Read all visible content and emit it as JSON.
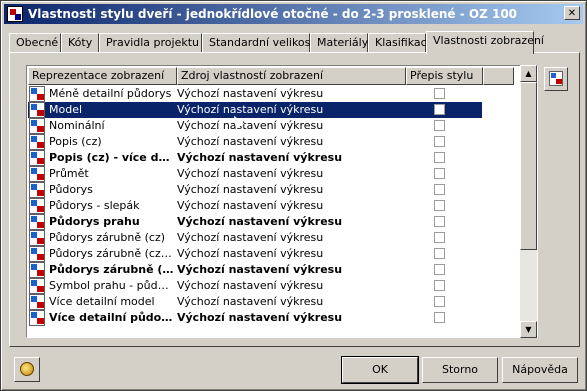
{
  "window": {
    "title": "Vlastnosti stylu dveří - jednokřídlové otočné - do 2-3 prosklené - OZ 100"
  },
  "tabs": [
    {
      "label": "Obecné"
    },
    {
      "label": "Kóty"
    },
    {
      "label": "Pravidla projektu"
    },
    {
      "label": "Standardní velikosti"
    },
    {
      "label": "Materiály"
    },
    {
      "label": "Klasifikace"
    },
    {
      "label": "Vlastnosti zobrazení",
      "active": true
    }
  ],
  "list": {
    "headers": {
      "representation": "Reprezentace zobrazení",
      "source": "Zdroj vlastností zobrazení",
      "override": "Přepis stylu"
    },
    "rows": [
      {
        "name": "Méně detailní půdorys",
        "source": "Výchozí nastavení výkresu",
        "bold": false,
        "selected": false
      },
      {
        "name": "Model",
        "source": "Výchozí nastavení výkresu",
        "bold": false,
        "selected": true
      },
      {
        "name": "Nominální",
        "source": "Výchozí nastavení výkresu",
        "bold": false,
        "selected": false
      },
      {
        "name": "Popis (cz)",
        "source": "Výchozí nastavení výkresu",
        "bold": false,
        "selected": false
      },
      {
        "name": "Popis (cz) - více det...",
        "source": "Výchozí nastavení výkresu",
        "bold": true,
        "selected": false
      },
      {
        "name": "Průmět",
        "source": "Výchozí nastavení výkresu",
        "bold": false,
        "selected": false
      },
      {
        "name": "Půdorys",
        "source": "Výchozí nastavení výkresu",
        "bold": false,
        "selected": false
      },
      {
        "name": "Půdorys - slepák",
        "source": "Výchozí nastavení výkresu",
        "bold": false,
        "selected": false
      },
      {
        "name": "Půdorys prahu",
        "source": "Výchozí nastavení výkresu",
        "bold": true,
        "selected": false
      },
      {
        "name": "Půdorys zárubně (cz)",
        "source": "Výchozí nastavení výkresu",
        "bold": false,
        "selected": false
      },
      {
        "name": "Půdorys zárubně (cz) - ...",
        "source": "Výchozí nastavení výkresu",
        "bold": false,
        "selected": false
      },
      {
        "name": "Půdorys zárubně (cz...",
        "source": "Výchozí nastavení výkresu",
        "bold": true,
        "selected": false
      },
      {
        "name": "Symbol prahu - půdorys",
        "source": "Výchozí nastavení výkresu",
        "bold": false,
        "selected": false
      },
      {
        "name": "Více detailní model",
        "source": "Výchozí nastavení výkresu",
        "bold": false,
        "selected": false
      },
      {
        "name": "Více detailní půdorys",
        "source": "Výchozí nastavení výkresu",
        "bold": true,
        "selected": false
      }
    ]
  },
  "buttons": {
    "ok": "OK",
    "cancel": "Storno",
    "help": "Nápověda"
  }
}
